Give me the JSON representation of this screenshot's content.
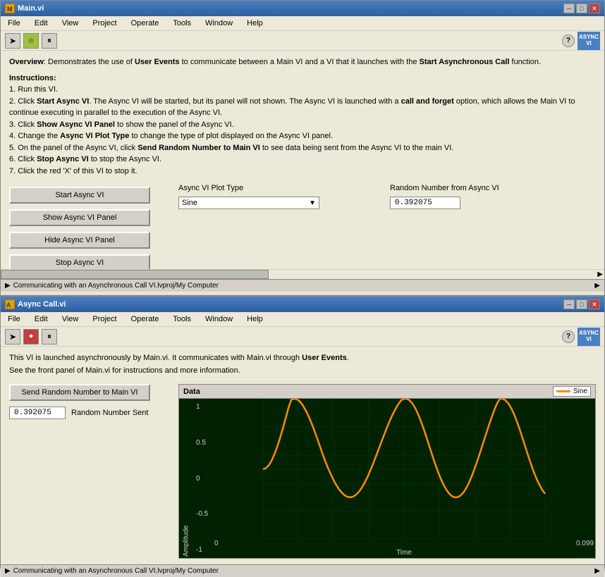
{
  "main_window": {
    "title": "Main.vi",
    "title_icon": "M",
    "overview_heading": "Overview",
    "overview_intro": ": Demonstrates the use of ",
    "overview_user_events": "User Events",
    "overview_rest1": " to communicate between a Main VI and a VI that it launches with the ",
    "overview_start_async": "Start Asynchronous Call",
    "overview_rest2": " function.",
    "instructions_heading": "Instructions:",
    "instructions": [
      "1. Run this VI.",
      "2. Click Start Async VI. The Async VI will be started, but its panel will not shown. The Async VI is launched with a call and forget option, which allows the Main VI to continue executing in parallel to the execution of the Async VI.",
      "3. Click Show Async VI Panel to show the panel of the Async VI.",
      "4. Change the Async VI Plot Type to change the type of plot displayed on the Async VI panel.",
      "5. On the panel of the Async VI, click Send Random Number to Main VI to see data being sent from the Async VI to the main VI.",
      "6. Click Stop Async VI to stop the Async VI.",
      "7. Click the red 'X' of this VI to stop it."
    ],
    "plot_type_label": "Async VI Plot Type",
    "plot_type_value": "Sine",
    "random_num_label": "Random Number from Async VI",
    "random_num_value": "0.392075",
    "btn_start": "Start Async VI",
    "btn_show": "Show Async VI Panel",
    "btn_hide": "Hide Async VI Panel",
    "btn_stop": "Stop Async VI",
    "menu_items": [
      "File",
      "Edit",
      "View",
      "Project",
      "Operate",
      "Tools",
      "Window",
      "Help"
    ],
    "status_bar_text": "Communicating with an Asynchronous Call VI.lvproj/My Computer"
  },
  "async_window": {
    "title": "Async Call.vi",
    "title_icon": "A",
    "desc1": "This VI is launched asynchronously by Main.vi. It communicates with Main.vi through ",
    "desc_bold": "User Events",
    "desc2": ".",
    "desc3": "See the front panel of Main.vi for instructions and more information.",
    "send_btn_label": "Send Random Number to Main VI",
    "random_num_value": "0.392075",
    "sent_label": "Random Number Sent",
    "chart_title": "Data",
    "chart_legend_label": "Sine",
    "y_axis_label": "Amplitude",
    "x_axis_label": "Time",
    "x_min": "0",
    "x_max": "0.099",
    "y_min": "-1",
    "y_max": "1",
    "y_ticks": [
      "1",
      "0.5",
      "0",
      "-0.5",
      "-1"
    ],
    "menu_items": [
      "File",
      "Edit",
      "View",
      "Project",
      "Operate",
      "Tools",
      "Window",
      "Help"
    ],
    "status_bar_text": "Communicating with an Asynchronous Call VI.lvproj/My Computer",
    "async_badge": "ASYNC VI"
  },
  "toolbar": {
    "run_icon": "▶",
    "stop_icon": "⏹",
    "pause_icon": "⏸",
    "help_icon": "?",
    "arrow_icon": "➤",
    "record_icon": "⏺"
  }
}
